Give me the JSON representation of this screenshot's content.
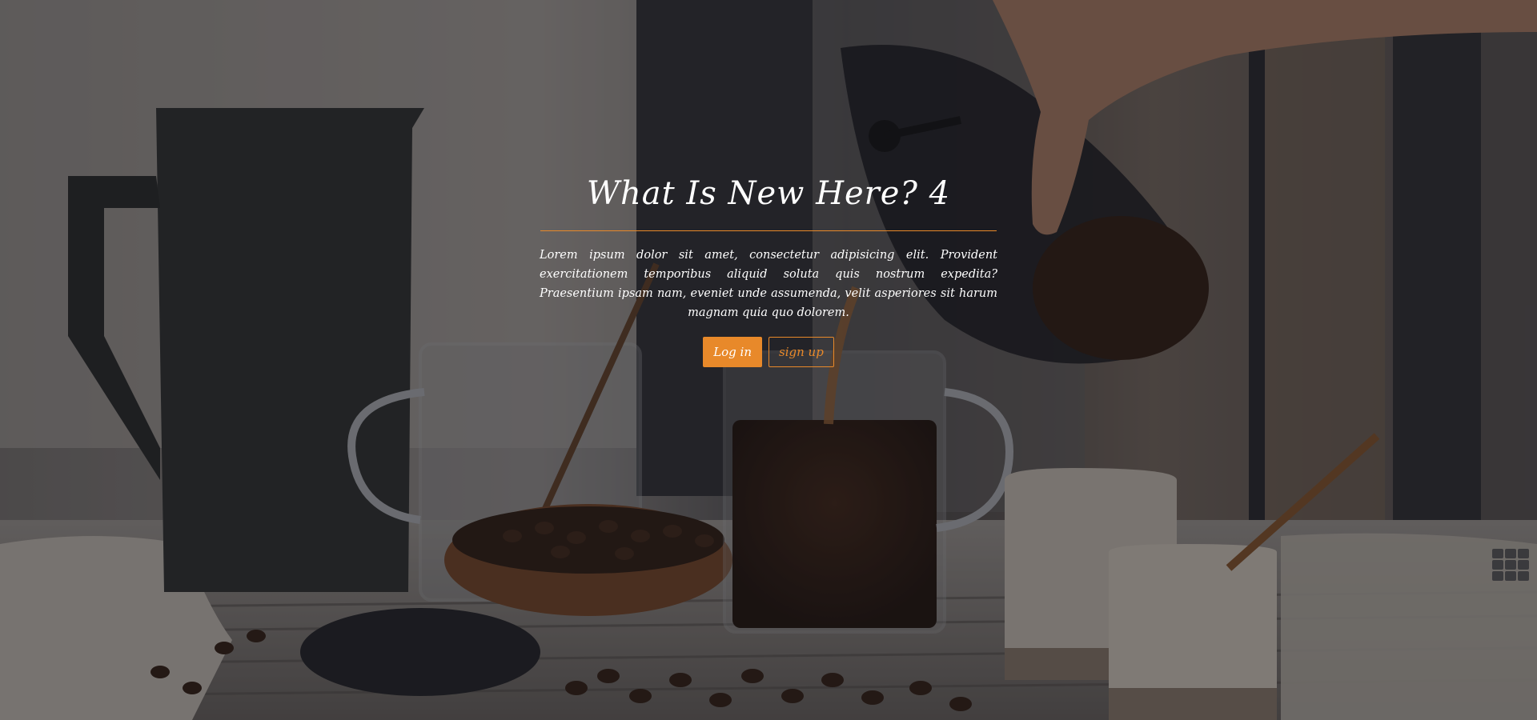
{
  "hero": {
    "title": "What Is New Here? 4",
    "description": "Lorem ipsum dolor sit amet, consectetur adipisicing elit. Provident exercitationem temporibus aliquid soluta quis nostrum expedita? Praesentium ipsam nam, eveniet unde assumenda, velit asperiores sit harum magnam quia quo dolorem.",
    "login_label": "Log in",
    "signup_label": "sign up"
  },
  "colors": {
    "accent": "#e8892a",
    "overlay": "rgba(20,20,30,0.38)"
  },
  "icons": {
    "grid_toggle": "grid-icon"
  }
}
